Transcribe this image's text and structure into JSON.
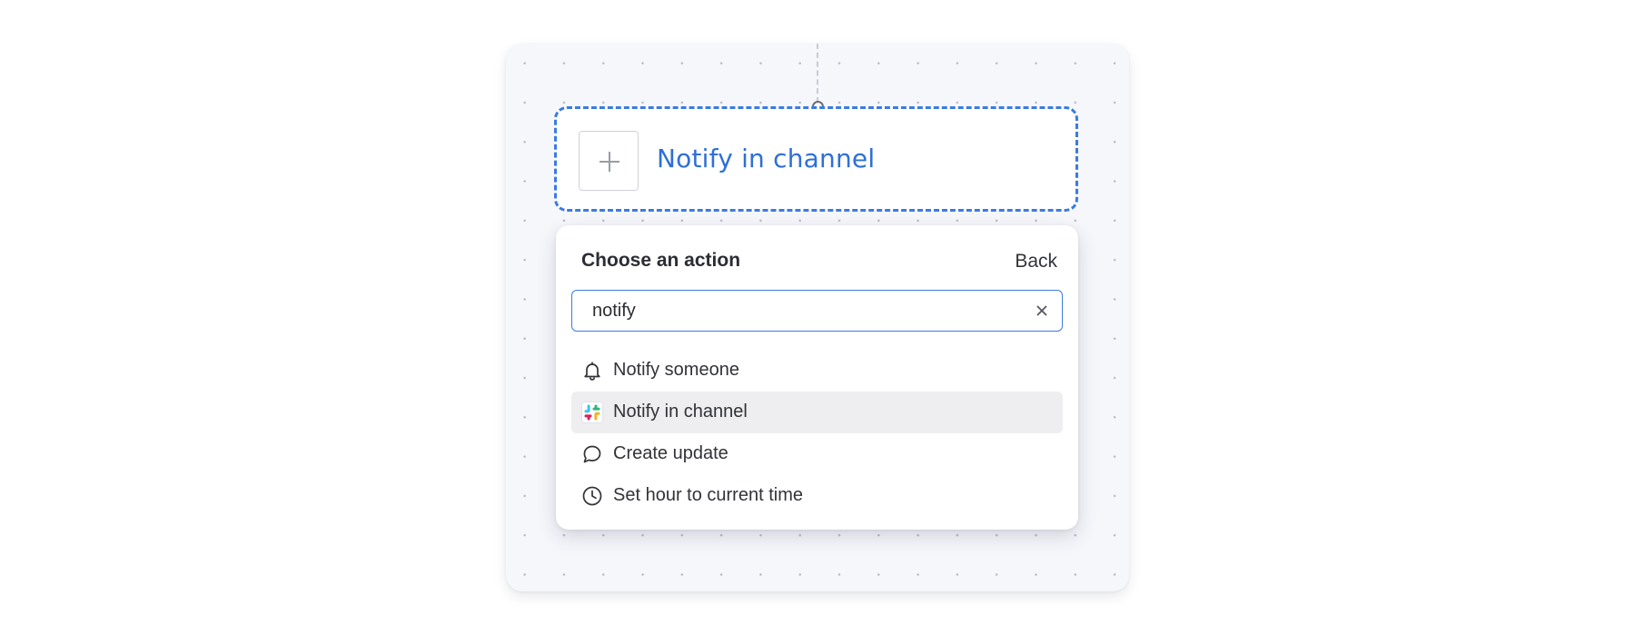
{
  "node": {
    "title": "Notify in channel",
    "add_icon": "plus-icon"
  },
  "dropdown": {
    "header": "Choose an action",
    "back_label": "Back",
    "search": {
      "value": "notify",
      "clear_icon": "close-icon"
    },
    "items": [
      {
        "label": "Notify someone",
        "icon": "bell-icon",
        "selected": false
      },
      {
        "label": "Notify in channel",
        "icon": "slack-icon",
        "selected": true
      },
      {
        "label": "Create update",
        "icon": "speech-bubble-icon",
        "selected": false
      },
      {
        "label": "Set hour to current time",
        "icon": "clock-icon",
        "selected": false
      }
    ]
  },
  "colors": {
    "accent": "#3b7be0",
    "title_blue": "#2f6fd6",
    "canvas_bg": "#f6f7fb",
    "selected_row": "#eeeef0",
    "text": "#323338"
  }
}
